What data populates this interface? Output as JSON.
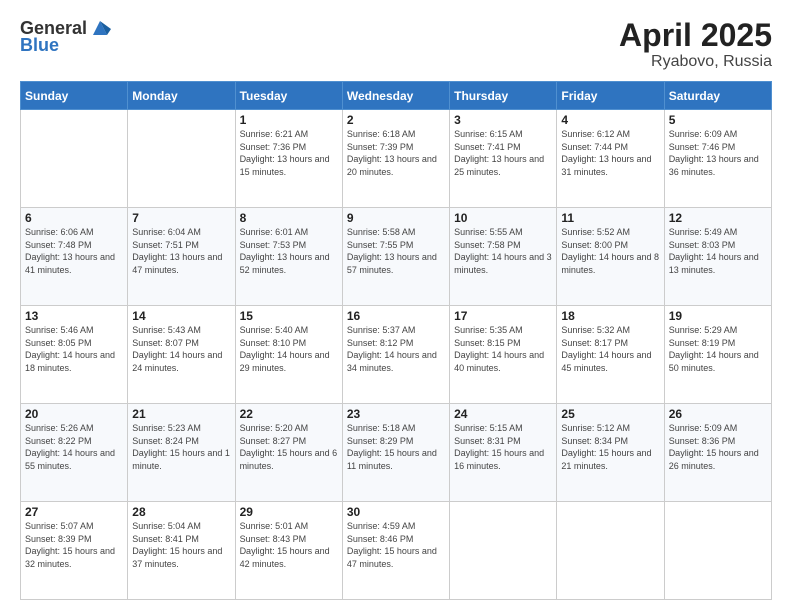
{
  "header": {
    "logo_general": "General",
    "logo_blue": "Blue",
    "title": "April 2025",
    "location": "Ryabovo, Russia"
  },
  "days_of_week": [
    "Sunday",
    "Monday",
    "Tuesday",
    "Wednesday",
    "Thursday",
    "Friday",
    "Saturday"
  ],
  "weeks": [
    [
      null,
      null,
      {
        "day": 1,
        "sunrise": "Sunrise: 6:21 AM",
        "sunset": "Sunset: 7:36 PM",
        "daylight": "Daylight: 13 hours and 15 minutes."
      },
      {
        "day": 2,
        "sunrise": "Sunrise: 6:18 AM",
        "sunset": "Sunset: 7:39 PM",
        "daylight": "Daylight: 13 hours and 20 minutes."
      },
      {
        "day": 3,
        "sunrise": "Sunrise: 6:15 AM",
        "sunset": "Sunset: 7:41 PM",
        "daylight": "Daylight: 13 hours and 25 minutes."
      },
      {
        "day": 4,
        "sunrise": "Sunrise: 6:12 AM",
        "sunset": "Sunset: 7:44 PM",
        "daylight": "Daylight: 13 hours and 31 minutes."
      },
      {
        "day": 5,
        "sunrise": "Sunrise: 6:09 AM",
        "sunset": "Sunset: 7:46 PM",
        "daylight": "Daylight: 13 hours and 36 minutes."
      }
    ],
    [
      {
        "day": 6,
        "sunrise": "Sunrise: 6:06 AM",
        "sunset": "Sunset: 7:48 PM",
        "daylight": "Daylight: 13 hours and 41 minutes."
      },
      {
        "day": 7,
        "sunrise": "Sunrise: 6:04 AM",
        "sunset": "Sunset: 7:51 PM",
        "daylight": "Daylight: 13 hours and 47 minutes."
      },
      {
        "day": 8,
        "sunrise": "Sunrise: 6:01 AM",
        "sunset": "Sunset: 7:53 PM",
        "daylight": "Daylight: 13 hours and 52 minutes."
      },
      {
        "day": 9,
        "sunrise": "Sunrise: 5:58 AM",
        "sunset": "Sunset: 7:55 PM",
        "daylight": "Daylight: 13 hours and 57 minutes."
      },
      {
        "day": 10,
        "sunrise": "Sunrise: 5:55 AM",
        "sunset": "Sunset: 7:58 PM",
        "daylight": "Daylight: 14 hours and 3 minutes."
      },
      {
        "day": 11,
        "sunrise": "Sunrise: 5:52 AM",
        "sunset": "Sunset: 8:00 PM",
        "daylight": "Daylight: 14 hours and 8 minutes."
      },
      {
        "day": 12,
        "sunrise": "Sunrise: 5:49 AM",
        "sunset": "Sunset: 8:03 PM",
        "daylight": "Daylight: 14 hours and 13 minutes."
      }
    ],
    [
      {
        "day": 13,
        "sunrise": "Sunrise: 5:46 AM",
        "sunset": "Sunset: 8:05 PM",
        "daylight": "Daylight: 14 hours and 18 minutes."
      },
      {
        "day": 14,
        "sunrise": "Sunrise: 5:43 AM",
        "sunset": "Sunset: 8:07 PM",
        "daylight": "Daylight: 14 hours and 24 minutes."
      },
      {
        "day": 15,
        "sunrise": "Sunrise: 5:40 AM",
        "sunset": "Sunset: 8:10 PM",
        "daylight": "Daylight: 14 hours and 29 minutes."
      },
      {
        "day": 16,
        "sunrise": "Sunrise: 5:37 AM",
        "sunset": "Sunset: 8:12 PM",
        "daylight": "Daylight: 14 hours and 34 minutes."
      },
      {
        "day": 17,
        "sunrise": "Sunrise: 5:35 AM",
        "sunset": "Sunset: 8:15 PM",
        "daylight": "Daylight: 14 hours and 40 minutes."
      },
      {
        "day": 18,
        "sunrise": "Sunrise: 5:32 AM",
        "sunset": "Sunset: 8:17 PM",
        "daylight": "Daylight: 14 hours and 45 minutes."
      },
      {
        "day": 19,
        "sunrise": "Sunrise: 5:29 AM",
        "sunset": "Sunset: 8:19 PM",
        "daylight": "Daylight: 14 hours and 50 minutes."
      }
    ],
    [
      {
        "day": 20,
        "sunrise": "Sunrise: 5:26 AM",
        "sunset": "Sunset: 8:22 PM",
        "daylight": "Daylight: 14 hours and 55 minutes."
      },
      {
        "day": 21,
        "sunrise": "Sunrise: 5:23 AM",
        "sunset": "Sunset: 8:24 PM",
        "daylight": "Daylight: 15 hours and 1 minute."
      },
      {
        "day": 22,
        "sunrise": "Sunrise: 5:20 AM",
        "sunset": "Sunset: 8:27 PM",
        "daylight": "Daylight: 15 hours and 6 minutes."
      },
      {
        "day": 23,
        "sunrise": "Sunrise: 5:18 AM",
        "sunset": "Sunset: 8:29 PM",
        "daylight": "Daylight: 15 hours and 11 minutes."
      },
      {
        "day": 24,
        "sunrise": "Sunrise: 5:15 AM",
        "sunset": "Sunset: 8:31 PM",
        "daylight": "Daylight: 15 hours and 16 minutes."
      },
      {
        "day": 25,
        "sunrise": "Sunrise: 5:12 AM",
        "sunset": "Sunset: 8:34 PM",
        "daylight": "Daylight: 15 hours and 21 minutes."
      },
      {
        "day": 26,
        "sunrise": "Sunrise: 5:09 AM",
        "sunset": "Sunset: 8:36 PM",
        "daylight": "Daylight: 15 hours and 26 minutes."
      }
    ],
    [
      {
        "day": 27,
        "sunrise": "Sunrise: 5:07 AM",
        "sunset": "Sunset: 8:39 PM",
        "daylight": "Daylight: 15 hours and 32 minutes."
      },
      {
        "day": 28,
        "sunrise": "Sunrise: 5:04 AM",
        "sunset": "Sunset: 8:41 PM",
        "daylight": "Daylight: 15 hours and 37 minutes."
      },
      {
        "day": 29,
        "sunrise": "Sunrise: 5:01 AM",
        "sunset": "Sunset: 8:43 PM",
        "daylight": "Daylight: 15 hours and 42 minutes."
      },
      {
        "day": 30,
        "sunrise": "Sunrise: 4:59 AM",
        "sunset": "Sunset: 8:46 PM",
        "daylight": "Daylight: 15 hours and 47 minutes."
      },
      null,
      null,
      null
    ]
  ]
}
